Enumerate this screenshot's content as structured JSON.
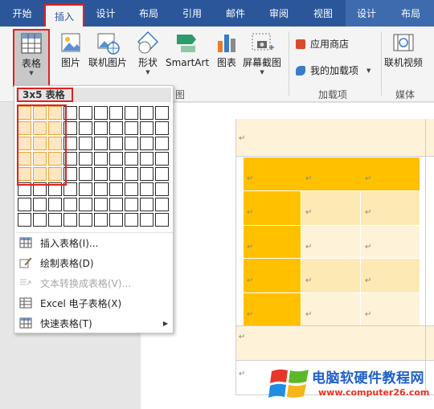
{
  "tabs": [
    {
      "label": "开始"
    },
    {
      "label": "插入"
    },
    {
      "label": "设计"
    },
    {
      "label": "布局"
    },
    {
      "label": "引用"
    },
    {
      "label": "邮件"
    },
    {
      "label": "审阅"
    },
    {
      "label": "视图"
    },
    {
      "label": "设计"
    },
    {
      "label": "布局"
    }
  ],
  "active_tab": "插入",
  "ribbon": {
    "table": {
      "label": "表格"
    },
    "picture": {
      "label": "图片"
    },
    "online_picture": {
      "label": "联机图片"
    },
    "shapes": {
      "label": "形状"
    },
    "smartart": {
      "label": "SmartArt"
    },
    "chart": {
      "label": "图表"
    },
    "screenshot": {
      "label": "屏幕截图"
    },
    "app_store": {
      "label": "应用商店"
    },
    "my_addins": {
      "label": "我的加载项"
    },
    "online_video": {
      "label": "联机视频"
    },
    "group_illustrations_fragment": "图",
    "group_addins": "加载项",
    "group_media": "媒体"
  },
  "dropdown": {
    "grid_label": "3x5 表格",
    "grid_cols": 10,
    "grid_rows": 8,
    "selected_cols": 3,
    "selected_rows": 5,
    "items": [
      {
        "label": "插入表格(I)...",
        "icon": "table-icon",
        "enabled": true
      },
      {
        "label": "绘制表格(D)",
        "icon": "pencil-icon",
        "enabled": true
      },
      {
        "label": "文本转换成表格(V)...",
        "icon": "convert-icon",
        "enabled": false
      },
      {
        "label": "Excel 电子表格(X)",
        "icon": "excel-icon",
        "enabled": true
      },
      {
        "label": "快速表格(T)",
        "icon": "table-icon",
        "enabled": true,
        "submenu": true
      }
    ]
  },
  "document": {
    "paragraph_mark": "↵"
  },
  "watermark": {
    "text": "电脑软硬件教程网",
    "url": "www.computer26.com"
  },
  "colors": {
    "tabbar": "#2b579a",
    "accent_red": "#e02020",
    "table_orange": "#ffc000",
    "table_light": "#fde9b3",
    "table_pale": "#fef3d8",
    "grid_selected": "#fde7c2"
  }
}
